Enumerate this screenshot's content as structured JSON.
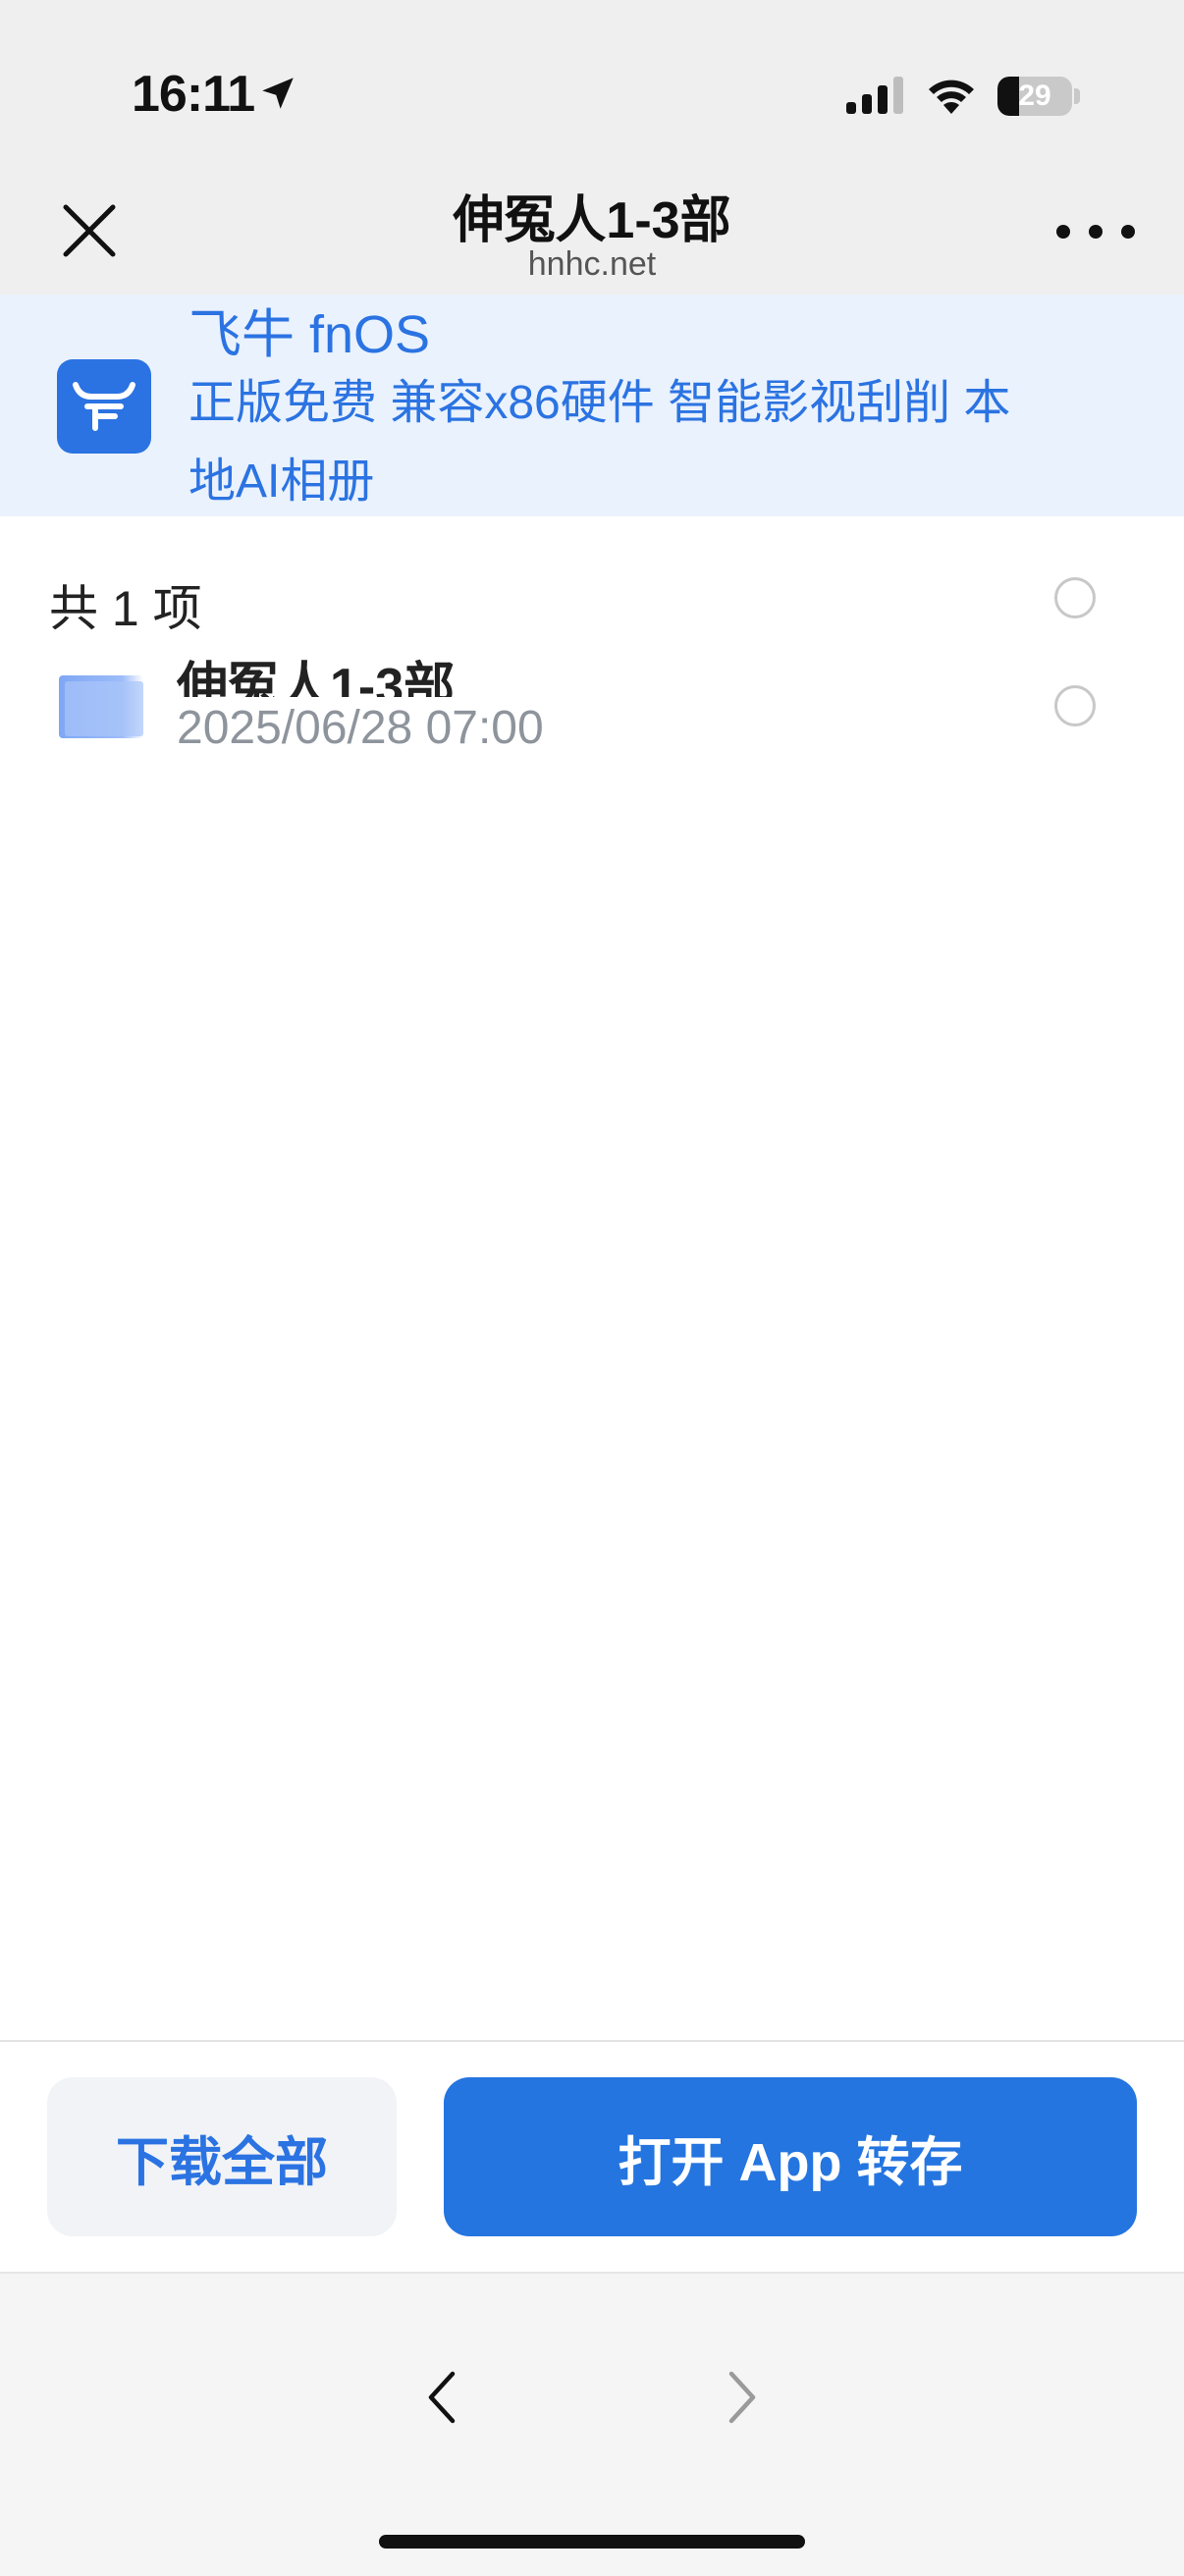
{
  "status_bar": {
    "time": "16:11",
    "battery_percent": 29,
    "battery_label": "29",
    "icons": [
      "location-arrow-icon",
      "signal-icon",
      "wifi-icon",
      "battery-icon"
    ]
  },
  "nav": {
    "title": "伸冤人1-3部",
    "subtitle": "hnhc.net",
    "close_icon": "close-icon",
    "more_icon": "more-icon"
  },
  "ad": {
    "logo_icon": "fnos-logo-icon",
    "title": "飞牛 fnOS",
    "line1": "正版免费 兼容x86硬件 智能影视刮削 本",
    "line2": "地AI相册",
    "accent_color": "#2b73e2"
  },
  "list": {
    "count_label": "共 1 项",
    "items": [
      {
        "name": "伸冤人1-3部",
        "date": "2025/06/28 07:00",
        "icon": "folder-icon"
      }
    ]
  },
  "actions": {
    "download_all": "下载全部",
    "open_app_save": "打开 App 转存",
    "primary_color": "#2475e0"
  },
  "browser": {
    "back_icon": "chevron-left-icon",
    "forward_icon": "chevron-right-icon"
  }
}
